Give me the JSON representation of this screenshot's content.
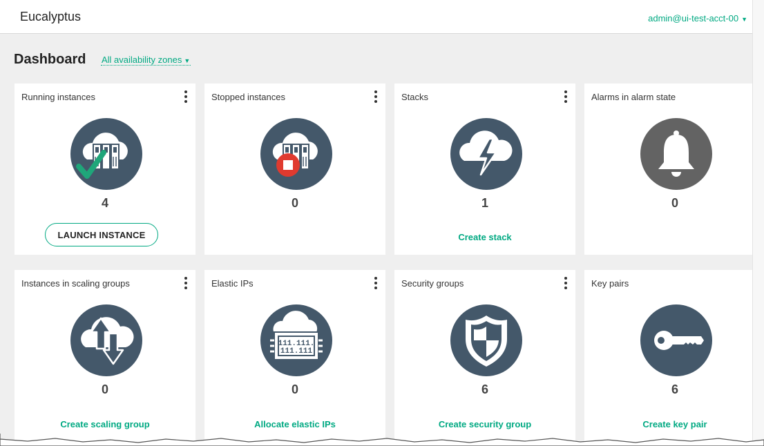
{
  "header": {
    "brand": "Eucalyptus",
    "user": "admin@ui-test-acct-00"
  },
  "dashboard": {
    "title": "Dashboard",
    "zone_filter": "All availability zones"
  },
  "cards": [
    {
      "title": "Running instances",
      "count": "4",
      "action": "LAUNCH INSTANCE",
      "icon": "running-instances-icon"
    },
    {
      "title": "Stopped instances",
      "count": "0",
      "icon": "stopped-instances-icon"
    },
    {
      "title": "Stacks",
      "count": "1",
      "action": "Create stack",
      "icon": "stacks-icon"
    },
    {
      "title": "Alarms in alarm state",
      "count": "0",
      "icon": "alarm-bell-icon"
    },
    {
      "title": "Instances in scaling groups",
      "count": "0",
      "action": "Create scaling group",
      "icon": "scaling-group-icon"
    },
    {
      "title": "Elastic IPs",
      "count": "0",
      "action": "Allocate elastic IPs",
      "icon": "elastic-ip-icon",
      "icon_text": [
        "111.111.",
        "111.111"
      ]
    },
    {
      "title": "Security groups",
      "count": "6",
      "action": "Create security group",
      "icon": "shield-icon"
    },
    {
      "title": "Key pairs",
      "count": "6",
      "action": "Create key pair",
      "icon": "key-icon"
    }
  ],
  "colors": {
    "accent": "#00a982",
    "icon_bg": "#44586a",
    "alarm_bg": "#636363",
    "stop_red": "#e03a2f",
    "check_green": "#1fa67a"
  }
}
